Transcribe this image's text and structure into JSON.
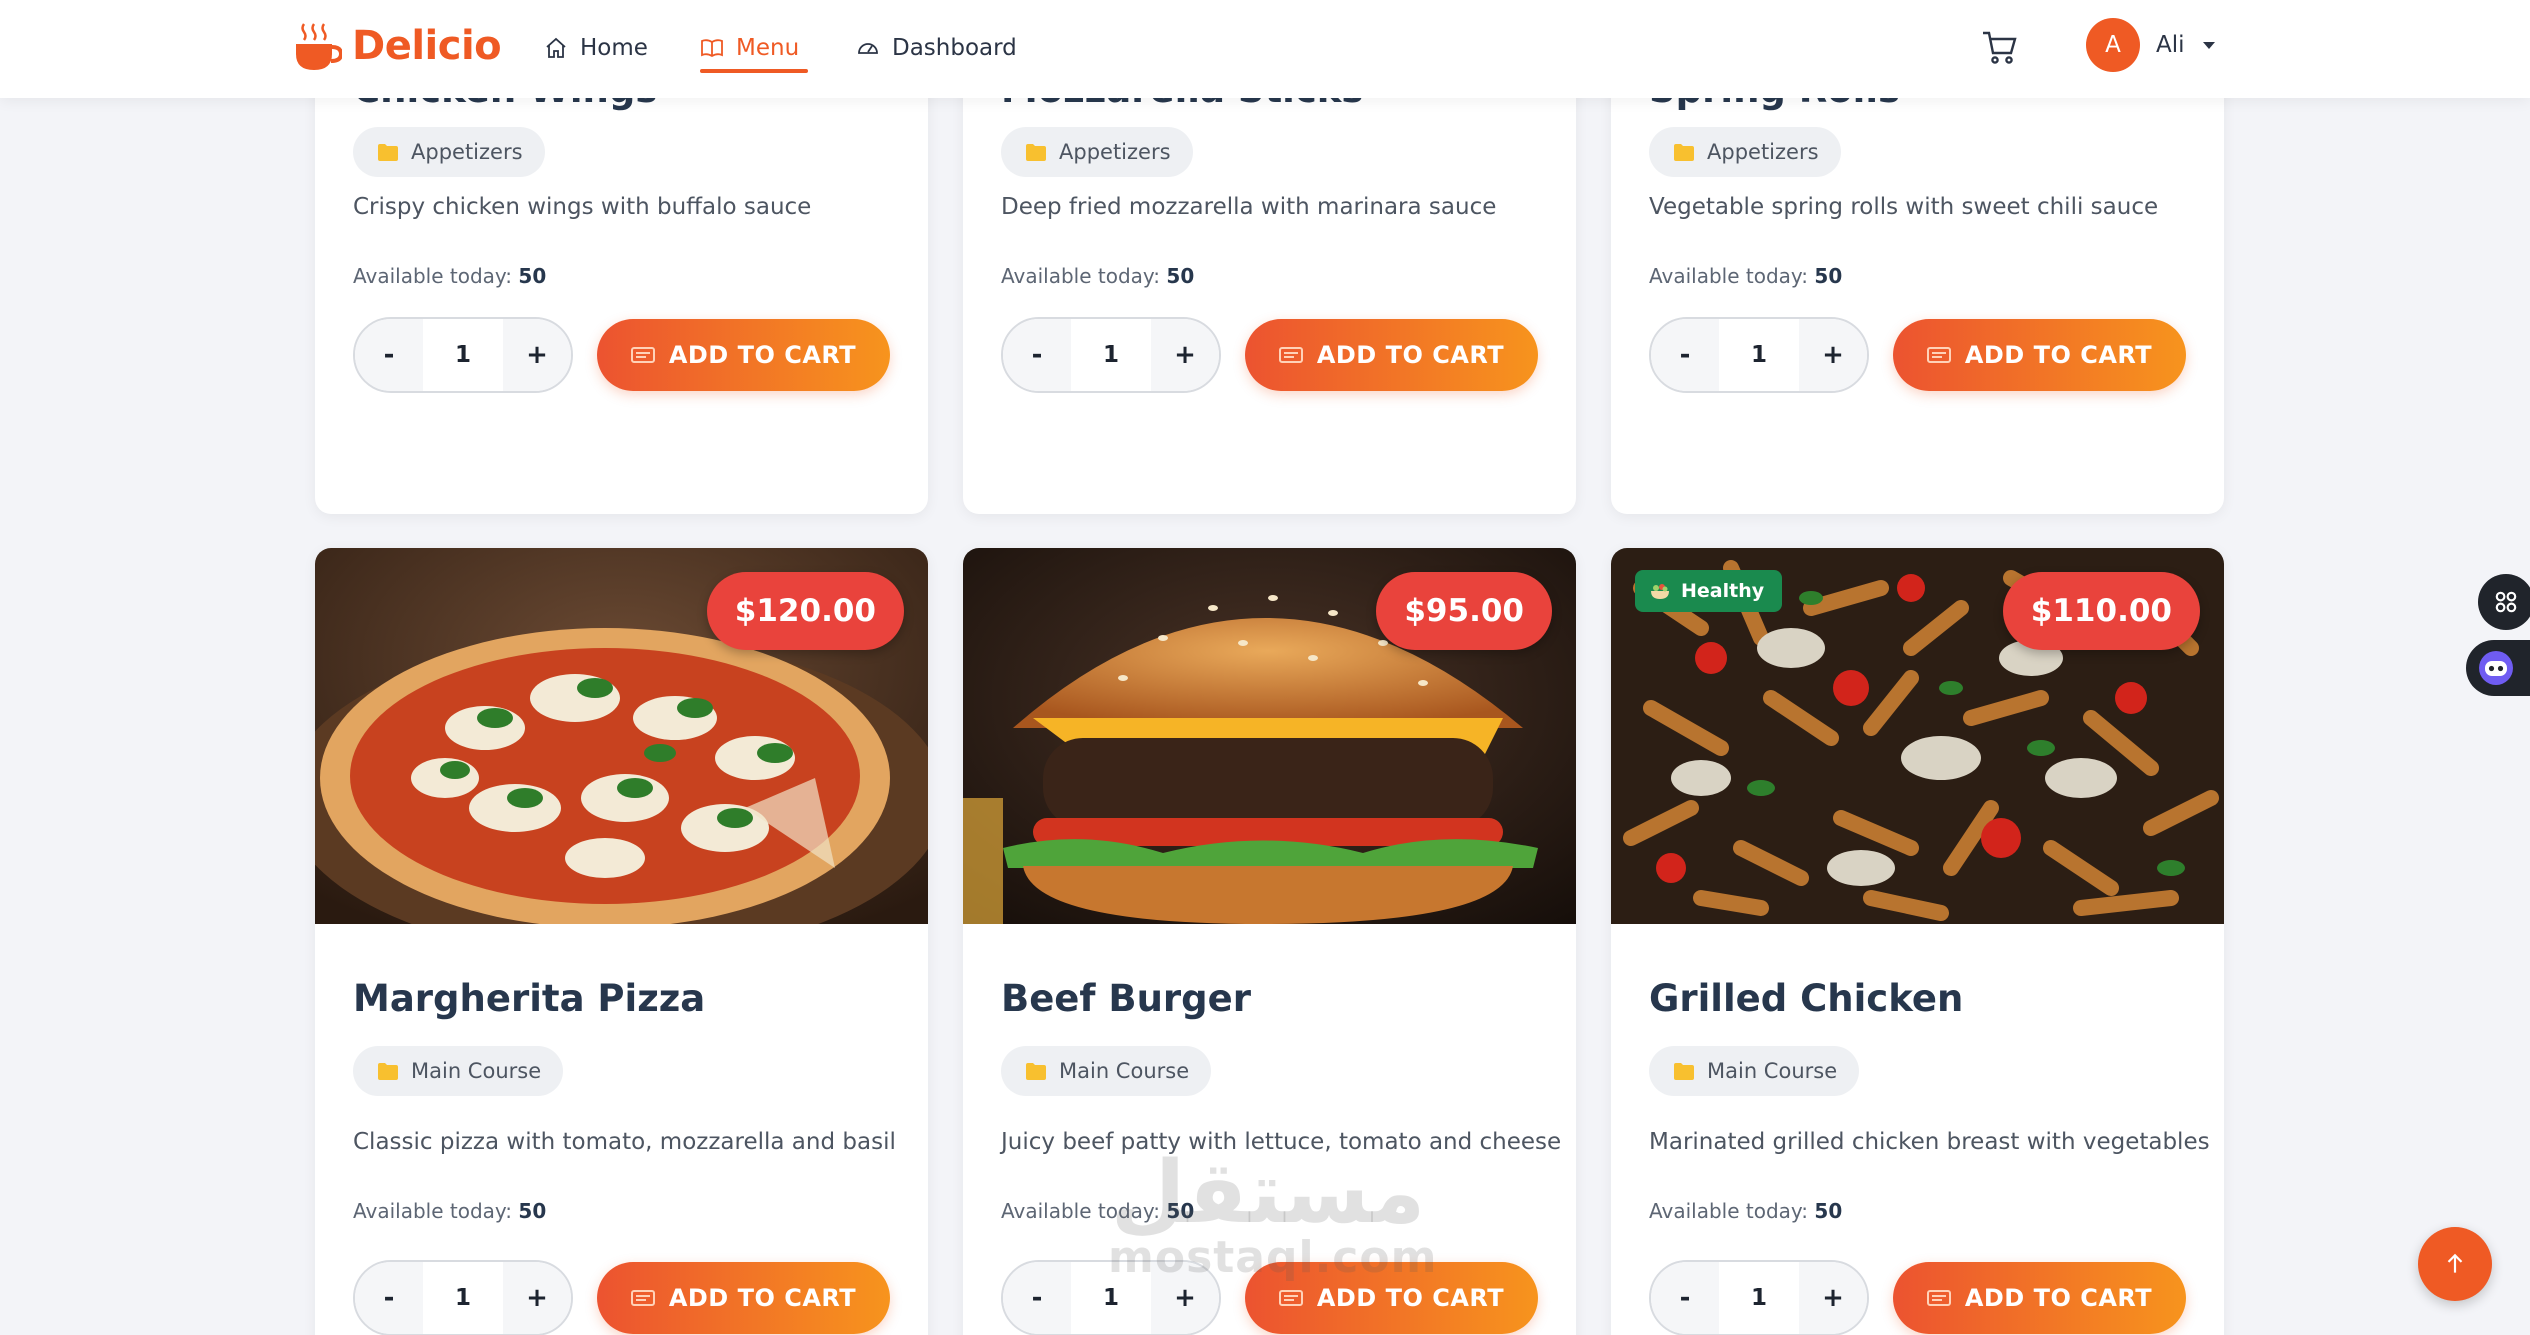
{
  "navbar": {
    "brand": "Delicio",
    "links": [
      {
        "label": "Home",
        "icon": "home-icon"
      },
      {
        "label": "Menu",
        "icon": "book-icon",
        "active": true
      },
      {
        "label": "Dashboard",
        "icon": "gauge-icon"
      }
    ],
    "user": {
      "initial": "A",
      "name": "Ali"
    }
  },
  "theme": {
    "accent": "#ef5a24",
    "price_badge": "#e9433c",
    "healthy_badge": "#1a8a4e",
    "button_gradient": [
      "#ec5330",
      "#f7941d"
    ]
  },
  "menu_items": [
    {
      "name": "Chicken Wings",
      "category": "Appetizers",
      "description": "Crispy chicken wings with buffalo sauce",
      "available_label": "Available today:",
      "available": "50",
      "quantity": "1",
      "button": "ADD TO CART"
    },
    {
      "name": "Mozzarella Sticks",
      "category": "Appetizers",
      "description": "Deep fried mozzarella with marinara sauce",
      "available_label": "Available today:",
      "available": "50",
      "quantity": "1",
      "button": "ADD TO CART"
    },
    {
      "name": "Spring Rolls",
      "category": "Appetizers",
      "description": "Vegetable spring rolls with sweet chili sauce",
      "available_label": "Available today:",
      "available": "50",
      "quantity": "1",
      "button": "ADD TO CART"
    },
    {
      "name": "Margherita Pizza",
      "category": "Main Course",
      "description": "Classic pizza with tomato, mozzarella and basil",
      "price": "$120.00",
      "available_label": "Available today:",
      "available": "50",
      "quantity": "1",
      "button": "ADD TO CART"
    },
    {
      "name": "Beef Burger",
      "category": "Main Course",
      "description": "Juicy beef patty with lettuce, tomato and cheese",
      "price": "$95.00",
      "available_label": "Available today:",
      "available": "50",
      "quantity": "1",
      "button": "ADD TO CART"
    },
    {
      "name": "Grilled Chicken",
      "category": "Main Course",
      "description": "Marinated grilled chicken breast with vegetables",
      "price": "$110.00",
      "badge": "Healthy",
      "available_label": "Available today:",
      "available": "50",
      "quantity": "1",
      "button": "ADD TO CART"
    }
  ],
  "qty_controls": {
    "minus": "-",
    "plus": "+"
  },
  "watermark": {
    "arabic": "مستقل",
    "latin": "mostaql.com"
  }
}
